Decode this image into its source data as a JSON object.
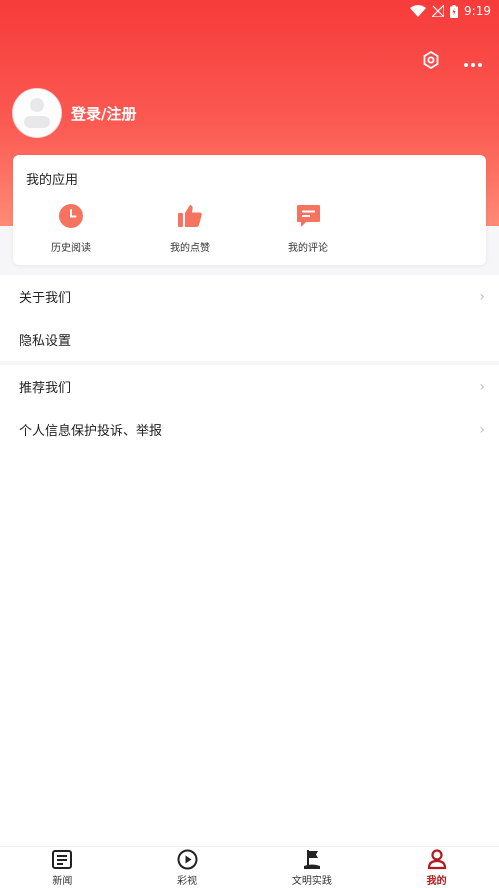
{
  "status_bar": {
    "time": "9:19"
  },
  "profile": {
    "login_label": "登录/注册"
  },
  "apps": {
    "title": "我的应用",
    "items": [
      {
        "label": "历史阅读",
        "icon": "clock-icon"
      },
      {
        "label": "我的点赞",
        "icon": "thumbs-up-icon"
      },
      {
        "label": "我的评论",
        "icon": "comment-icon"
      }
    ]
  },
  "menu": {
    "group1": [
      {
        "label": "关于我们"
      },
      {
        "label": "隐私设置"
      }
    ],
    "group2": [
      {
        "label": "推荐我们"
      },
      {
        "label": "个人信息保护投诉、举报"
      }
    ]
  },
  "tabs": [
    {
      "label": "新闻",
      "icon": "news-icon"
    },
    {
      "label": "彩视",
      "icon": "play-icon"
    },
    {
      "label": "文明实践",
      "icon": "flag-icon"
    },
    {
      "label": "我的",
      "icon": "user-icon",
      "active": true
    }
  ],
  "colors": {
    "header_top": "#f73b3b",
    "header_bottom": "#ff8a75",
    "app_icon": "#f6735f",
    "active_tab": "#b21a1f"
  }
}
